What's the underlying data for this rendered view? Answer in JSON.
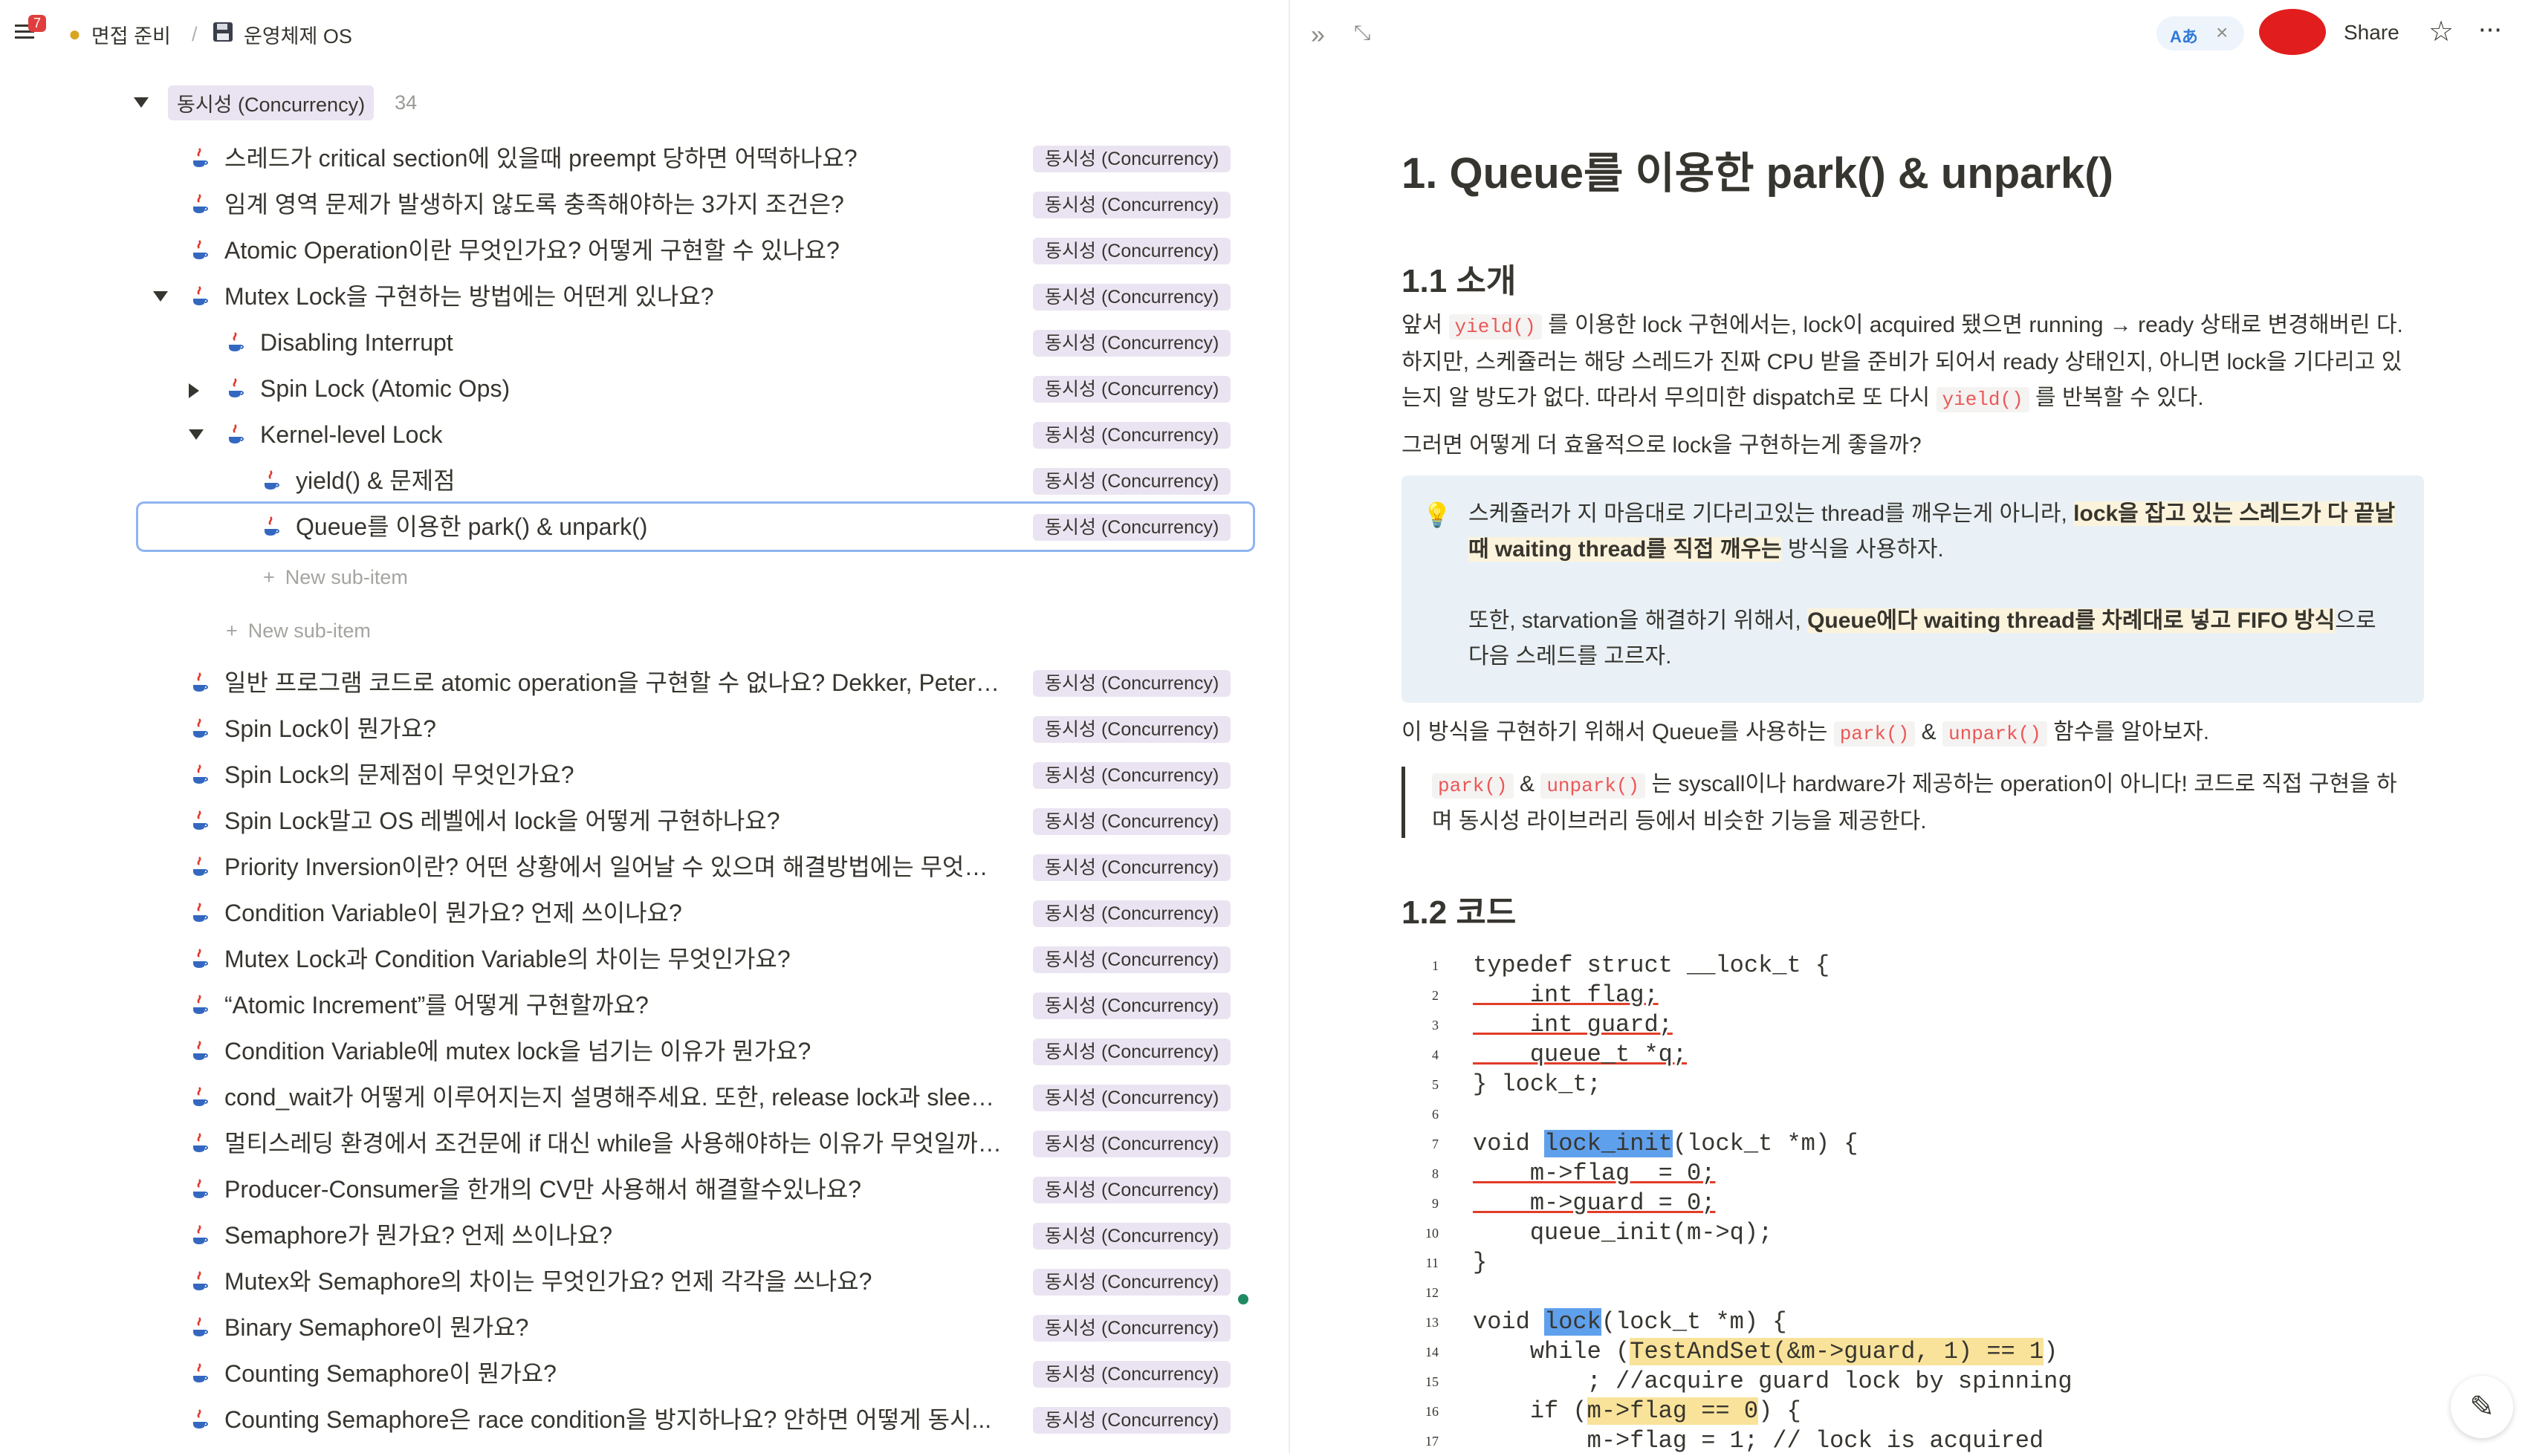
{
  "topbar": {
    "menu_badge": "7",
    "crumb1_label": "면접 준비",
    "crumb2_label": "운영체제 OS",
    "translate_label": "Aあ",
    "share_label": "Share"
  },
  "group": {
    "label": "동시성 (Concurrency)",
    "count": "34"
  },
  "tag_label": "동시성 (Concurrency)",
  "rows": [
    "스레드가 critical section에 있을때 preempt 당하면 어떡하나요?",
    "임계 영역 문제가 발생하지 않도록 충족해야하는 3가지 조건은?",
    "Atomic Operation이란 무엇인가요? 어떻게 구현할 수 있나요?",
    "Mutex Lock을 구현하는 방법에는 어떤게 있나요?",
    "Disabling Interrupt",
    "Spin Lock (Atomic Ops)",
    "Kernel-level Lock",
    "yield() & 문제점",
    "Queue를 이용한 park() & unpark()",
    "일반 프로그램 코드로 atomic operation을 구현할 수 없나요? Dekker, Peters...",
    "Spin Lock이 뭔가요?",
    "Spin Lock의 문제점이 무엇인가요?",
    "Spin Lock말고 OS 레벨에서 lock을 어떻게 구현하나요?",
    "Priority Inversion이란? 어떤 상황에서 일어날 수 있으며 해결방법에는 무엇이 ...",
    "Condition Variable이 뭔가요? 언제 쓰이나요?",
    "Mutex Lock과 Condition Variable의 차이는 무엇인가요?",
    "“Atomic Increment”를 어떻게 구현할까요?",
    "Condition Variable에 mutex lock을 넘기는 이유가 뭔가요?",
    "cond_wait가 어떻게 이루어지는지 설명해주세요. 또한, release lock과 sleep...",
    "멀티스레딩 환경에서 조건문에 if 대신 while을 사용해야하는 이유가 무엇일까요?",
    "Producer-Consumer을 한개의 CV만 사용해서 해결할수있나요?",
    "Semaphore가 뭔가요? 언제 쓰이나요?",
    "Mutex와 Semaphore의 차이는 무엇인가요? 언제 각각을 쓰나요?",
    "Binary Semaphore이 뭔가요?",
    "Counting Semaphore이 뭔가요?",
    "Counting Semaphore은 race condition을 방지하나요? 안하면 어떻게 동시..."
  ],
  "new_sub_item": "New sub-item",
  "doc": {
    "title": "1. Queue를 이용한 park() & unpark()",
    "h_intro": "1.1 소개",
    "p1_a": "앞서 ",
    "p1_code1": "yield()",
    "p1_b": " 를 이용한 lock 구현에서는, lock이 acquired 됐으면 running → ready 상태로 변경해버린 다. 하지만, 스케쥴러는 해당 스레드가 진짜 CPU 받을 준비가 되어서 ready 상태인지, 아니면 lock을 기다리고 있는지 알 방도가 없다. 따라서 무의미한 dispatch로 또 다시 ",
    "p1_code2": "yield()",
    "p1_c": " 를 반복할 수 있다.",
    "p2": "그러면 어떻게 더 효율적으로 lock을 구현하는게 좋을까?",
    "callout_a": "스케쥴러가 지 마음대로 기다리고있는 thread를 깨우는게 아니라, ",
    "callout_hl1": "lock을 잡고 있는 스레드가 다 끝날때 waiting thread를 직접 깨우는",
    "callout_b": " 방식을 사용하자.",
    "callout_c": "또한, starvation을 해결하기 위해서, ",
    "callout_hl2": "Queue에다 waiting thread를 차례대로 넣고 FIFO 방식",
    "callout_d": "으로 다음 스레드를 고르자.",
    "p3_a": "이 방식을 구현하기 위해서 Queue를 사용하는 ",
    "p3_code1": "park()",
    "p3_b": " & ",
    "p3_code2": "unpark()",
    "p3_c": " 함수를 알아보자.",
    "q_code1": "park()",
    "q_b": " & ",
    "q_code2": "unpark()",
    "q_c": " 는 syscall이나 hardware가 제공하는 operation이 아니다! 코드로 직접 구현을 하며 동시성 라이브러리 등에서 비슷한 기능을 제공한다.",
    "h_code": "1.2 코드",
    "code_lines": [
      "typedef struct __lock_t {",
      "    int flag;",
      "    int guard;",
      "    queue_t *q;",
      "} lock_t;",
      "",
      "void lock_init(lock_t *m) {",
      "    m->flag  = 0;",
      "    m->guard = 0;",
      "    queue_init(m->q);",
      "}",
      "",
      "void lock(lock_t *m) {",
      "    while (TestAndSet(&m->guard, 1) == 1)",
      "        ; //acquire guard lock by spinning",
      "    if (m->flag == 0) {",
      "        m->flag = 1; // lock is acquired"
    ]
  }
}
